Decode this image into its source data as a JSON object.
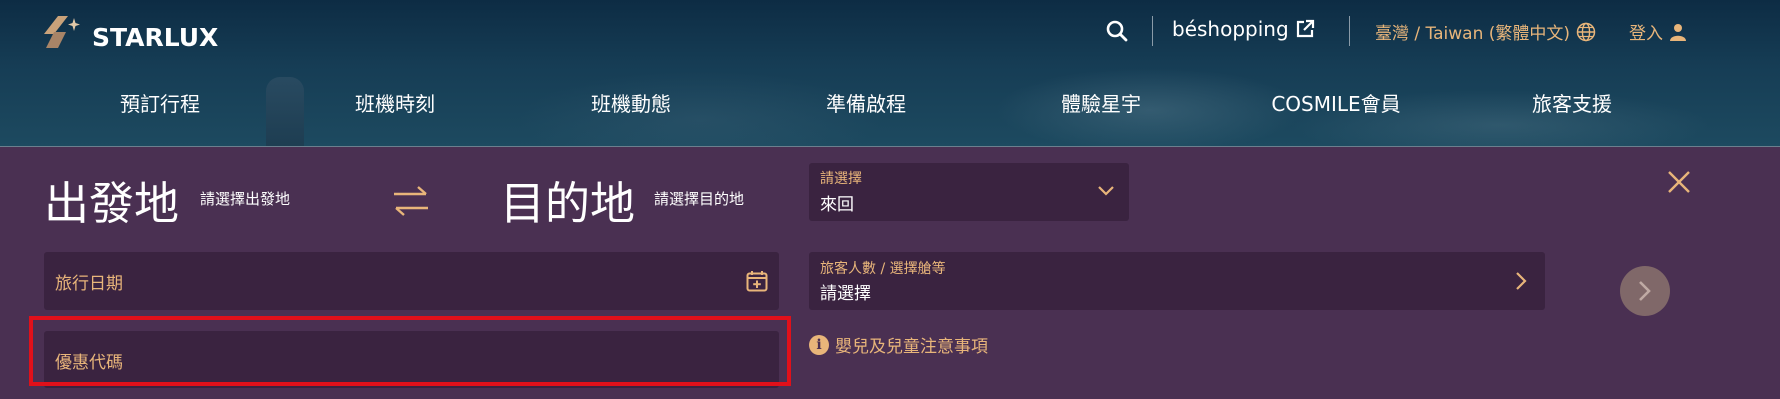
{
  "header": {
    "logo_text": "STARLUX",
    "search_icon": "search-icon",
    "beshopping_label": "béshopping",
    "language_label": "臺灣 / Taiwan (繁體中文)",
    "login_label": "登入"
  },
  "nav": {
    "items": [
      {
        "label": "預訂行程"
      },
      {
        "label": "班機時刻"
      },
      {
        "label": "班機動態"
      },
      {
        "label": "準備啟程"
      },
      {
        "label": "體驗星宇"
      },
      {
        "label": "COSMILE會員"
      },
      {
        "label": "旅客支援"
      }
    ]
  },
  "booking": {
    "origin_title": "出發地",
    "origin_hint": "請選擇出發地",
    "destination_title": "目的地",
    "destination_hint": "請選擇目的地",
    "trip_type": {
      "label": "請選擇",
      "value": "來回"
    },
    "travel_date_label": "旅行日期",
    "passengers": {
      "label": "旅客人數 / 選擇艙等",
      "value": "請選擇"
    },
    "promo_code_label": "優惠代碼",
    "infant_notice": "嬰兒及兒童注意事項"
  },
  "colors": {
    "header_bg": "#163d55",
    "panel_bg": "#4a3052",
    "field_bg": "#3a2340",
    "accent_gold": "#e8b57a",
    "highlight_red": "#e0101a"
  }
}
